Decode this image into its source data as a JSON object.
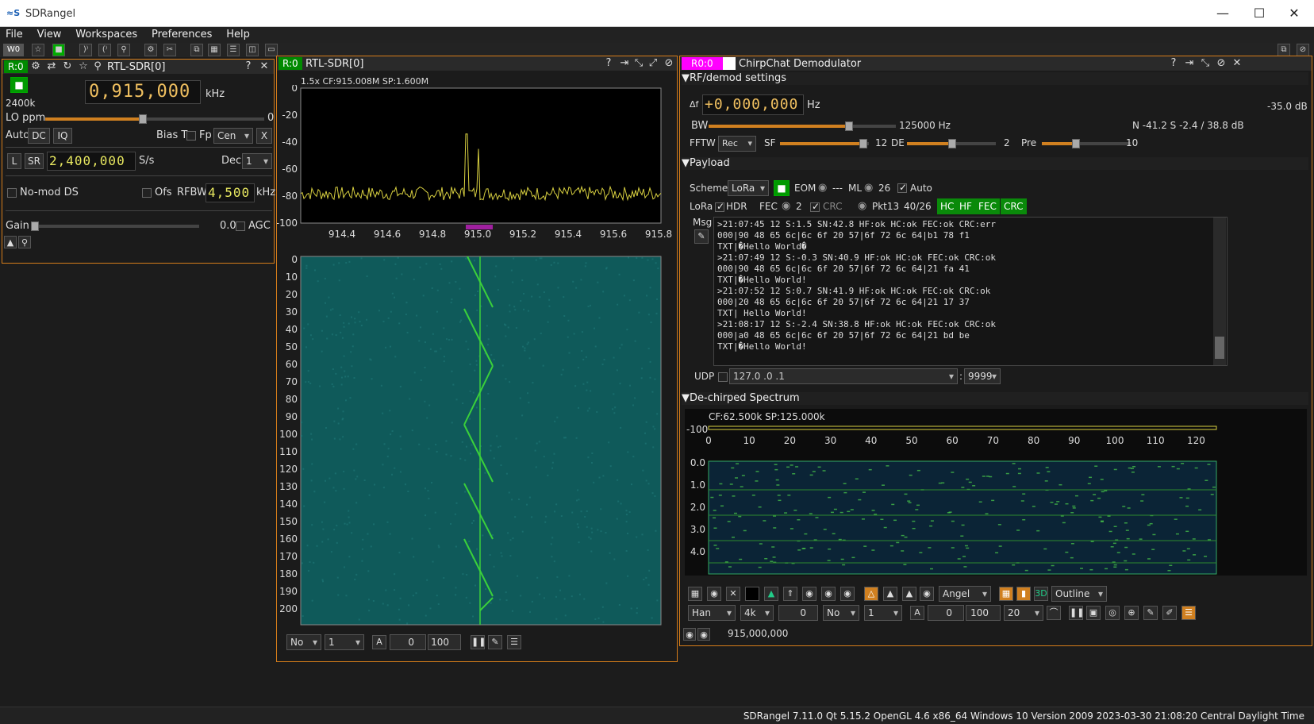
{
  "window": {
    "title": "SDRangel",
    "logo": "≈S"
  },
  "menu": [
    "File",
    "View",
    "Workspaces",
    "Preferences",
    "Help"
  ],
  "toolbar": {
    "workspace": "W0"
  },
  "device": {
    "rtag": "R:0",
    "title": "RTL-SDR[0]",
    "freq": "0,915,000",
    "freq_unit": "kHz",
    "sr_label": "2400k",
    "lo_label": "LO ppm",
    "lo_value": "0",
    "auto": "Auto",
    "dc": "DC",
    "iq": "IQ",
    "biast": "Bias T",
    "fp": "Fp",
    "fp_sel": "Cen",
    "x": "X",
    "l": "L",
    "sr": "SR",
    "srval": "2,400,000",
    "sr_unit": "S/s",
    "dec_label": "Dec",
    "dec_val": "1",
    "nomod": "No-mod DS",
    "ofs": "Ofs",
    "rfbw": "RFBW",
    "rfbw_val": "4,500",
    "rfbw_unit": "kHz",
    "gain": "Gain",
    "gain_val": "0.0",
    "agc": "AGC"
  },
  "spectrum": {
    "rtag": "R:0",
    "title": "RTL-SDR[0]",
    "info": "1.5x CF:915.008M SP:1.600M",
    "y_ticks": [
      "0",
      "-20",
      "-40",
      "-60",
      "-80",
      "-100"
    ],
    "x_ticks": [
      "914.4",
      "914.6",
      "914.8",
      "915.0",
      "915.2",
      "915.4",
      "915.6",
      "915.8"
    ],
    "wf_ticks": [
      "0",
      "10",
      "20",
      "30",
      "40",
      "50",
      "60",
      "70",
      "80",
      "90",
      "100",
      "110",
      "120",
      "130",
      "140",
      "150",
      "160",
      "170",
      "180",
      "190",
      "200"
    ],
    "bottom": {
      "no": "No",
      "one": "1",
      "a": "A",
      "zero": "0",
      "hundred": "100"
    }
  },
  "demod": {
    "rtag": "R0:0",
    "title": "ChirpChat Demodulator",
    "rf_section": "▼RF/demod settings",
    "df_label": "Δf",
    "df_val": "+0,000,000",
    "df_unit": "Hz",
    "level": "-35.0 dB",
    "bw_label": "BW",
    "bw_val": "125000 Hz",
    "noise": "N -41.2 S  -2.4 / 38.8 dB",
    "fftw": "FFTW",
    "fftw_sel": "Rec",
    "sf": "SF",
    "sf_val": "12",
    "de": "DE",
    "de_val": "2",
    "pre": "Pre",
    "pre_val": "10",
    "payload_section": "▼Payload",
    "scheme": "Scheme",
    "scheme_sel": "LoRa",
    "eom": "EOM",
    "eom_val": "---",
    "ml": "ML",
    "ml_val": "26",
    "auto": "Auto",
    "lora": "LoRa",
    "hdr": "HDR",
    "fec": "FEC",
    "fec_val": "2",
    "crc": "CRC",
    "pkt": "Pkt13",
    "pktcount": "40/26",
    "badges": [
      "HC",
      "HF",
      "FEC",
      "CRC"
    ],
    "msg": "Msg",
    "messages": [
      ">21:07:45 12 S:1.5 SN:42.8 HF:ok HC:ok FEC:ok CRC:err",
      "000|90 48 65 6c|6c 6f 20 57|6f 72 6c 64|b1 78 f1",
      "TXT|�Hello World�",
      ">21:07:49 12 S:-0.3 SN:40.9 HF:ok HC:ok FEC:ok CRC:ok",
      "000|90 48 65 6c|6c 6f 20 57|6f 72 6c 64|21 fa 41",
      "TXT|�Hello World!",
      ">21:07:52 12 S:0.7 SN:41.9 HF:ok HC:ok FEC:ok CRC:ok",
      "000|20 48 65 6c|6c 6f 20 57|6f 72 6c 64|21 17 37",
      "TXT| Hello World!",
      ">21:08:17 12 S:-2.4 SN:38.8 HF:ok HC:ok FEC:ok CRC:ok",
      "000|a0 48 65 6c|6c 6f 20 57|6f 72 6c 64|21 bd be",
      "TXT|�Hello World!"
    ],
    "udp": "UDP",
    "udp_addr": "127.0 .0 .1",
    "udp_port": "9999",
    "dechirp_section": "▼De-chirped Spectrum",
    "dc_info": "CF:62.500k SP:125.000k",
    "dc_ylabel": "-100",
    "dc_xticks": [
      "0",
      "10",
      "20",
      "30",
      "40",
      "50",
      "60",
      "70",
      "80",
      "90",
      "100",
      "110",
      "120"
    ],
    "dc_wticks": [
      "0.0",
      "1.0",
      "2.0",
      "3.0",
      "4.0"
    ],
    "ctrl1": {
      "angel": "Angel",
      "outline": "Outline"
    },
    "ctrl2": {
      "han": "Han",
      "fft": "4k",
      "zero": "0",
      "no": "No",
      "one": "1",
      "a": "A",
      "zero2": "0",
      "hundred": "100",
      "twenty": "20"
    },
    "freq_readout": "915,000,000"
  },
  "status": "SDRangel 7.11.0 Qt 5.15.2 OpenGL 4.6 x86_64 Windows 10 Version 2009  2023-03-30 21:08:20 Central Daylight Time",
  "colors": {
    "accent": "#d67d1a",
    "green": "#009a00",
    "magenta": "#ff00ff",
    "spectrum_trace": "#d8d040",
    "waterfall": "#0f5a5a"
  }
}
